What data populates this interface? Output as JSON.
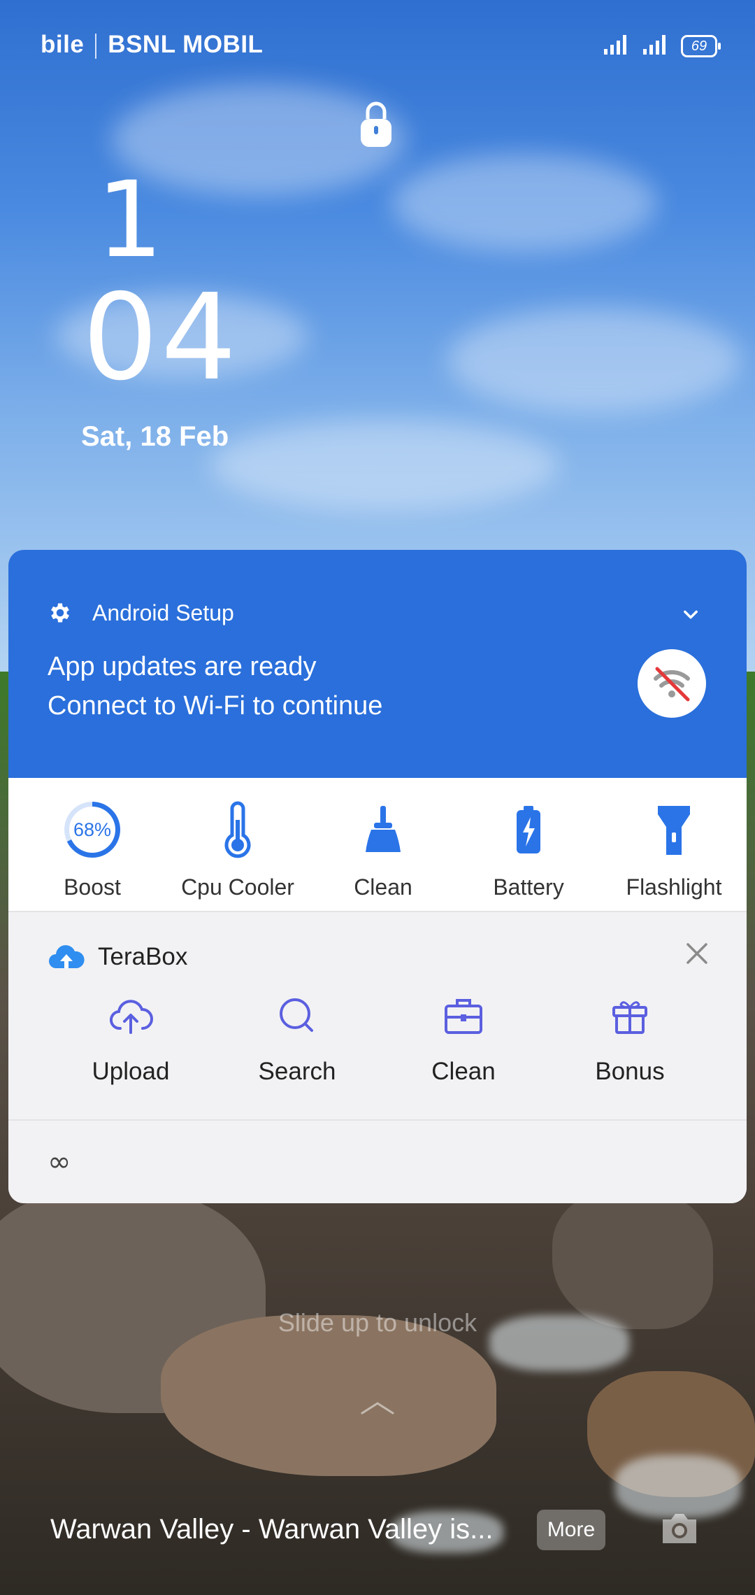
{
  "status_bar": {
    "carrier_1": "bile",
    "carrier_2": "BSNL MOBIL",
    "battery_level": "69"
  },
  "lock_screen": {
    "clock_hour": "1",
    "clock_minute": "04",
    "date": "Sat, 18 Feb"
  },
  "notification": {
    "app_name": "Android Setup",
    "line1": "App updates are ready",
    "line2": "Connect to Wi-Fi to continue",
    "icons": [
      "gear-icon",
      "chevron-down-icon",
      "wifi-off-icon"
    ]
  },
  "tools": {
    "boost_percent": "68%",
    "items": [
      {
        "label": "Boost",
        "icon": "boost-ring-icon"
      },
      {
        "label": "Cpu Cooler",
        "icon": "thermometer-icon"
      },
      {
        "label": "Clean",
        "icon": "broom-icon"
      },
      {
        "label": "Battery",
        "icon": "battery-icon"
      },
      {
        "label": "Flashlight",
        "icon": "flashlight-icon"
      }
    ]
  },
  "terabox": {
    "title": "TeraBox",
    "buttons": [
      {
        "label": "Upload",
        "icon": "cloud-upload-icon"
      },
      {
        "label": "Search",
        "icon": "search-icon"
      },
      {
        "label": "Clean",
        "icon": "toolbox-icon"
      },
      {
        "label": "Bonus",
        "icon": "gift-icon"
      }
    ]
  },
  "footer": {
    "symbol": "∞"
  },
  "bottom": {
    "slide_hint": "Slide up to unlock",
    "caption": "Warwan Valley - Warwan Valley is...",
    "more_label": "More"
  },
  "colors": {
    "notification_bg": "#2a6fdb",
    "accent_blue": "#2a74e8",
    "terabox_icon": "#5b5fe0"
  }
}
